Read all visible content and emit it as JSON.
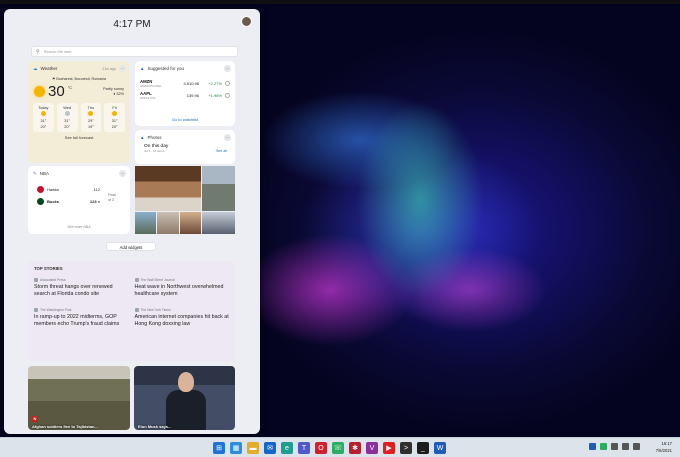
{
  "colors": {
    "accent": "#1a6bc7",
    "positive": "#1a8a3a",
    "taskbar": "#dde3ea"
  },
  "widgets": {
    "time": "4:17 PM",
    "search_placeholder": "Search the web",
    "weather": {
      "title": "Weather",
      "updated": "21m ago",
      "location": "Bucharest, Bucuresti, Romania",
      "temp": "30",
      "unit": "°C",
      "condition": "Partly sunny",
      "humidity": "32%",
      "days": [
        {
          "name": "Today",
          "icon": "sun",
          "hi": "31°",
          "lo": "20°"
        },
        {
          "name": "Wed",
          "icon": "cloud",
          "hi": "31°",
          "lo": "20°"
        },
        {
          "name": "Thu",
          "icon": "sun",
          "hi": "29°",
          "lo": "19°"
        },
        {
          "name": "Fri",
          "icon": "sun",
          "hi": "31°",
          "lo": "20°"
        }
      ],
      "footer": "See full forecast"
    },
    "stocks": {
      "title": "Suggested for you",
      "items": [
        {
          "symbol": "AMZN",
          "name": "AMAZON.COM...",
          "price": "3,510.98",
          "change": "+2.27%"
        },
        {
          "symbol": "AAPL",
          "name": "APPLE INC.",
          "price": "139.96",
          "change": "+1.96%"
        }
      ],
      "footer": "Go to watchlist"
    },
    "photos": {
      "title": "Photos",
      "subtitle": "On this day",
      "date": "Jul 6 · 16 items",
      "see_all": "See all"
    },
    "nba": {
      "title": "NBA",
      "teams": [
        {
          "name": "Hawks",
          "score": "112",
          "color": "#c8102e"
        },
        {
          "name": "Bucks",
          "score": "123 ×",
          "color": "#00471b"
        }
      ],
      "status": [
        "Final",
        "ot 3"
      ],
      "footer": "See more NBA"
    },
    "add_widgets": "Add widgets",
    "top_stories": {
      "header": "TOP STORIES",
      "stories": [
        {
          "source": "Associated Press",
          "headline": "Storm threat hangs over renewed search at Florida condo site"
        },
        {
          "source": "The Wall Street Journal",
          "headline": "Heat wave in Northwest overwhelmed healthcare system"
        },
        {
          "source": "The Washington Post",
          "headline": "In ramp-up to 2022 midterms, GOP members echo Trump's fraud claims"
        },
        {
          "source": "The New York Times",
          "headline": "American internet companies hit back at Hong Kong doxxing law"
        }
      ]
    },
    "news_cards": [
      {
        "caption": "Afghan soldiers flee to Tajikistan..."
      },
      {
        "caption": "Elon Musk says..."
      }
    ]
  },
  "taskbar": {
    "icons": [
      {
        "name": "start-icon",
        "color": "#1e74d6",
        "glyph": "⊞"
      },
      {
        "name": "widgets-icon",
        "color": "#2a8fd8",
        "glyph": "▦"
      },
      {
        "name": "file-explorer-icon",
        "color": "#e3ad2b",
        "glyph": "▬"
      },
      {
        "name": "mail-icon",
        "color": "#1466c8",
        "glyph": "✉"
      },
      {
        "name": "edge-icon",
        "color": "#1d9e8f",
        "glyph": "e"
      },
      {
        "name": "teams-icon",
        "color": "#5059c9",
        "glyph": "T"
      },
      {
        "name": "opera-icon",
        "color": "#d11f2d",
        "glyph": "O"
      },
      {
        "name": "whatsapp-icon",
        "color": "#27ae60",
        "glyph": "☏"
      },
      {
        "name": "app-icon-red",
        "color": "#b5202f",
        "glyph": "✱"
      },
      {
        "name": "vivaldi-icon",
        "color": "#8c2f9a",
        "glyph": "V"
      },
      {
        "name": "youtube-icon",
        "color": "#e02020",
        "glyph": "▶"
      },
      {
        "name": "terminal-icon",
        "color": "#2f2f2f",
        "glyph": ">"
      },
      {
        "name": "terminal-dark-icon",
        "color": "#1c1c1c",
        "glyph": "_"
      },
      {
        "name": "word-icon",
        "color": "#1f5cb6",
        "glyph": "W"
      }
    ],
    "time": "16:17",
    "date": "7/6/2021"
  }
}
